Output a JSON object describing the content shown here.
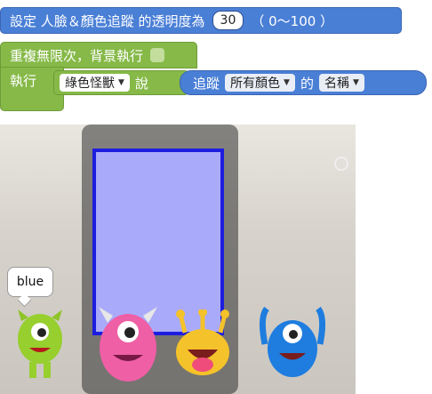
{
  "blocks": {
    "set_transparency": {
      "label": "設定 人臉＆顏色追蹤 的透明度為",
      "value": "30",
      "range": "（ 0～100 ）"
    },
    "forever": {
      "label": "重複無限次，背景執行"
    },
    "execute": {
      "label": "執行",
      "sprite_dropdown": "綠色怪獸",
      "say_label": "說",
      "track_label": "追蹤",
      "color_dropdown": "所有顏色",
      "of_label": "的",
      "name_dropdown": "名稱"
    }
  },
  "stage": {
    "speech_bubble": "blue",
    "sprites": [
      "green-monster",
      "pink-monster",
      "yellow-monster",
      "blue-monster"
    ]
  },
  "colors": {
    "block_blue": "#4a7fd6",
    "block_green": "#86b948",
    "tracking_box": "#1d1de0"
  }
}
